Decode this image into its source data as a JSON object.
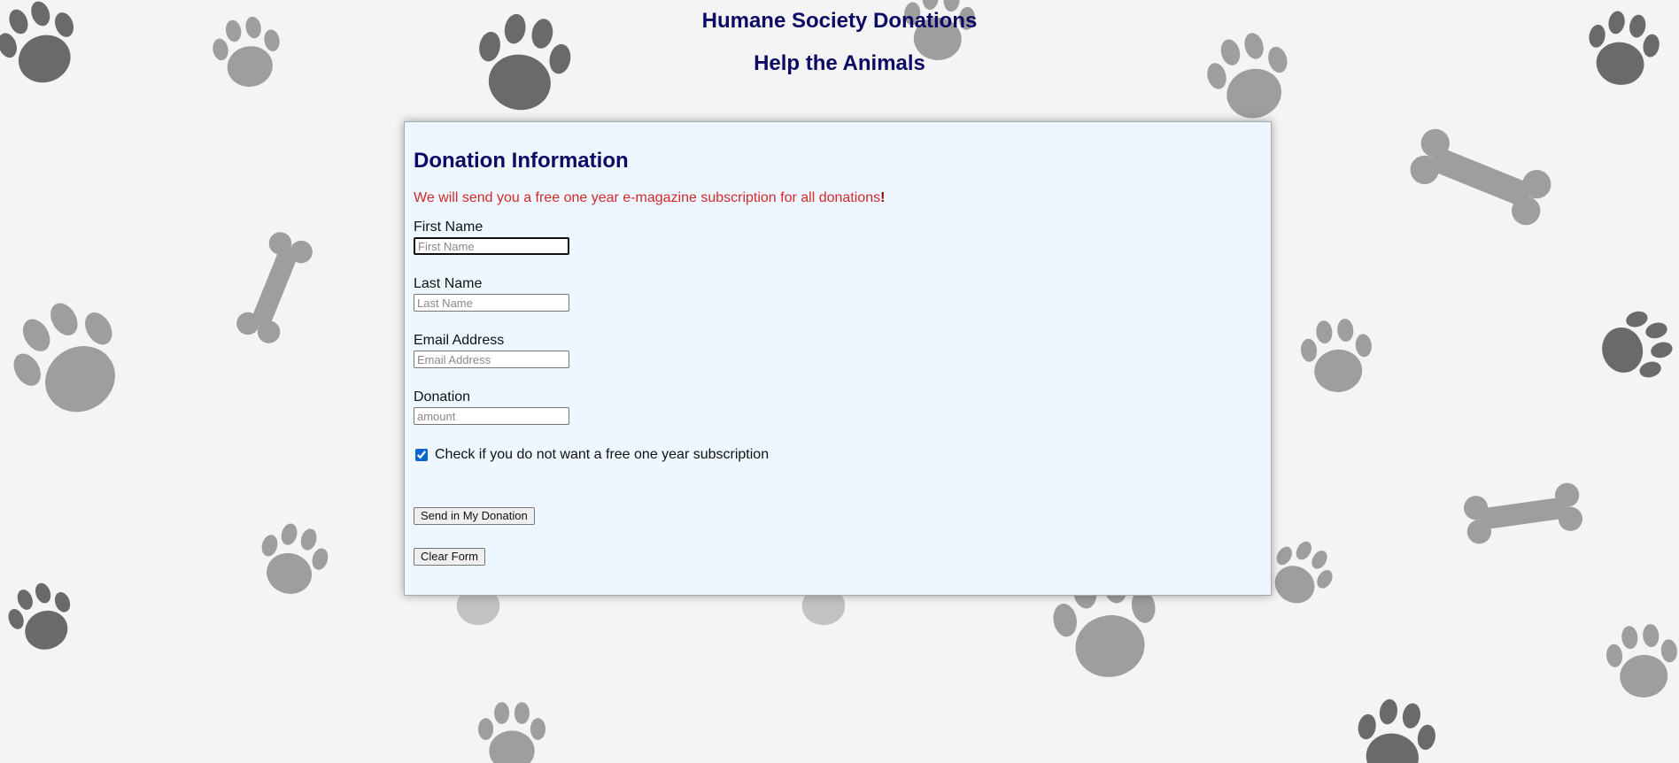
{
  "header": {
    "title": "Humane Society Donations",
    "subtitle": "Help the Animals"
  },
  "form": {
    "title": "Donation Information",
    "promo_text": "We will send you a free one year e-magazine subscription for all donations",
    "promo_bang": "!",
    "fields": [
      {
        "label": "First Name",
        "placeholder": "First Name",
        "value": ""
      },
      {
        "label": "Last Name",
        "placeholder": "Last Name",
        "value": ""
      },
      {
        "label": "Email Address",
        "placeholder": "Email Address",
        "value": ""
      },
      {
        "label": "Donation",
        "placeholder": "amount",
        "value": ""
      }
    ],
    "checkbox": {
      "label": "Check if you do not want a free one year subscription",
      "checked": true
    },
    "submit_label": "Send in My Donation",
    "clear_label": "Clear Form"
  },
  "background": {
    "pattern": "paw-prints-and-bones",
    "icons": [
      "paw-print-icon",
      "bone-icon"
    ],
    "colors": {
      "page": "#f4f4f4",
      "paw_light": "#9e9e9e",
      "paw_dark": "#6a6a6a"
    }
  },
  "colors": {
    "heading": "#0b0b66",
    "promo": "#d12a2a",
    "panel": "#eef7ff"
  }
}
